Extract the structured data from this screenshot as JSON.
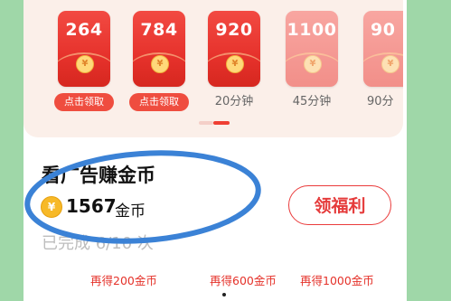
{
  "envelopes": [
    {
      "amount": "264",
      "coin": "¥",
      "label": "点击领取",
      "type": "claim"
    },
    {
      "amount": "784",
      "coin": "¥",
      "label": "点击领取",
      "type": "claim"
    },
    {
      "amount": "920",
      "coin": "¥",
      "label": "20分钟",
      "type": "time"
    },
    {
      "amount": "1100",
      "coin": "¥",
      "label": "45分钟",
      "type": "time"
    },
    {
      "amount": "90",
      "coin": "¥",
      "label": "90分",
      "type": "time"
    }
  ],
  "section": {
    "title": "看广告赚金币",
    "coin_symbol": "¥",
    "coin_count": "1567",
    "coin_unit": "金币",
    "progress_text": "已完成 6/10 次",
    "claim_button": "领福利"
  },
  "bonuses": [
    "再得200金币",
    "再得600金币",
    "再得1000金币"
  ],
  "colors": {
    "accent": "#e5322a",
    "highlight": "#3b82d6",
    "background": "#9fd7a8"
  }
}
